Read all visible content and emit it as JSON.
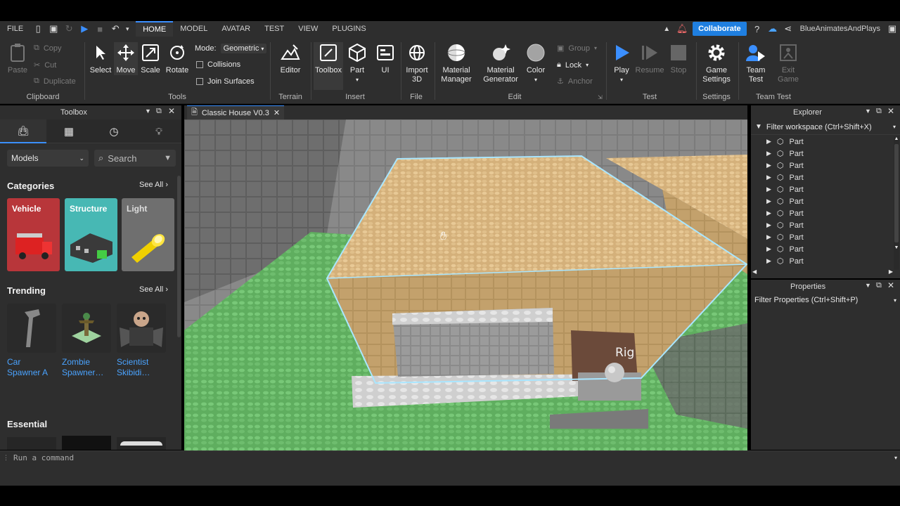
{
  "menubar": {
    "file": "FILE",
    "tabs": [
      "HOME",
      "MODEL",
      "AVATAR",
      "TEST",
      "VIEW",
      "PLUGINS"
    ],
    "collaborate": "Collaborate",
    "username": "BlueAnimatesAndPlays"
  },
  "ribbon": {
    "clipboard": {
      "paste": "Paste",
      "copy": "Copy",
      "cut": "Cut",
      "duplicate": "Duplicate",
      "label": "Clipboard"
    },
    "tools": {
      "select": "Select",
      "move": "Move",
      "scale": "Scale",
      "rotate": "Rotate",
      "mode_label": "Mode:",
      "mode_value": "Geometric",
      "collisions": "Collisions",
      "join_surfaces": "Join Surfaces",
      "label": "Tools"
    },
    "terrain": {
      "editor": "Editor",
      "label": "Terrain"
    },
    "insert": {
      "toolbox": "Toolbox",
      "part": "Part",
      "ui": "UI",
      "label": "Insert"
    },
    "file": {
      "import3d_1": "Import",
      "import3d_2": "3D",
      "label": "File"
    },
    "edit": {
      "material_manager_1": "Material",
      "material_manager_2": "Manager",
      "material_generator_1": "Material",
      "material_generator_2": "Generator",
      "color": "Color",
      "group": "Group",
      "lock": "Lock",
      "anchor": "Anchor",
      "label": "Edit"
    },
    "test": {
      "play": "Play",
      "resume": "Resume",
      "stop": "Stop",
      "label": "Test"
    },
    "settings": {
      "game_settings_1": "Game",
      "game_settings_2": "Settings",
      "label": "Settings"
    },
    "team_test": {
      "team_test_1": "Team",
      "team_test_2": "Test",
      "exit_game_1": "Exit",
      "exit_game_2": "Game",
      "label": "Team Test"
    }
  },
  "toolbox": {
    "title": "Toolbox",
    "dropdown": "Models",
    "search_placeholder": "Search",
    "categories_title": "Categories",
    "see_all": "See All",
    "categories": [
      "Vehicle",
      "Structure",
      "Light"
    ],
    "trending_title": "Trending",
    "trending": [
      {
        "line1": "Car",
        "line2": "Spawner A"
      },
      {
        "line1": "Zombie",
        "line2": "Spawner…"
      },
      {
        "line1": "Scientist",
        "line2": "Skibidi…"
      }
    ],
    "essential_title": "Essential"
  },
  "document_tab": {
    "title": "Classic House V0.3"
  },
  "viewport": {
    "rig_label": "Rig"
  },
  "explorer": {
    "title": "Explorer",
    "filter_placeholder": "Filter workspace (Ctrl+Shift+X)",
    "items": [
      "Part",
      "Part",
      "Part",
      "Part",
      "Part",
      "Part",
      "Part",
      "Part",
      "Part",
      "Part",
      "Part"
    ]
  },
  "properties": {
    "title": "Properties",
    "filter_placeholder": "Filter Properties (Ctrl+Shift+P)"
  },
  "command_bar": {
    "placeholder": "Run a command"
  },
  "colors": {
    "accent": "#3b8fff",
    "collaborate": "#1f7fe0",
    "link": "#4aa3ff",
    "bg": "#2e2e2e"
  }
}
